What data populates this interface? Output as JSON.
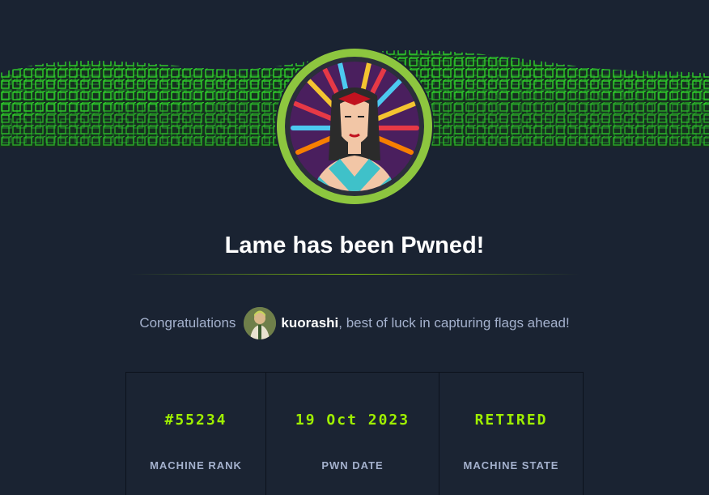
{
  "page": {
    "title": "Lame has been Pwned!"
  },
  "congrats": {
    "prefix": "Congratulations",
    "username": "kuorashi",
    "suffix": ", best of luck in capturing flags ahead!"
  },
  "stats": [
    {
      "value": "#55234",
      "label": "MACHINE RANK"
    },
    {
      "value": "19 Oct 2023",
      "label": "PWN DATE"
    },
    {
      "value": "RETIRED",
      "label": "MACHINE STATE"
    }
  ],
  "colors": {
    "background": "#1a2332",
    "accent": "#9fef00",
    "muted_text": "#a4b1cd",
    "ring": "#8dc63f"
  },
  "icons": {
    "machine_avatar": "machine-avatar-icon",
    "user_avatar": "user-avatar-icon"
  }
}
